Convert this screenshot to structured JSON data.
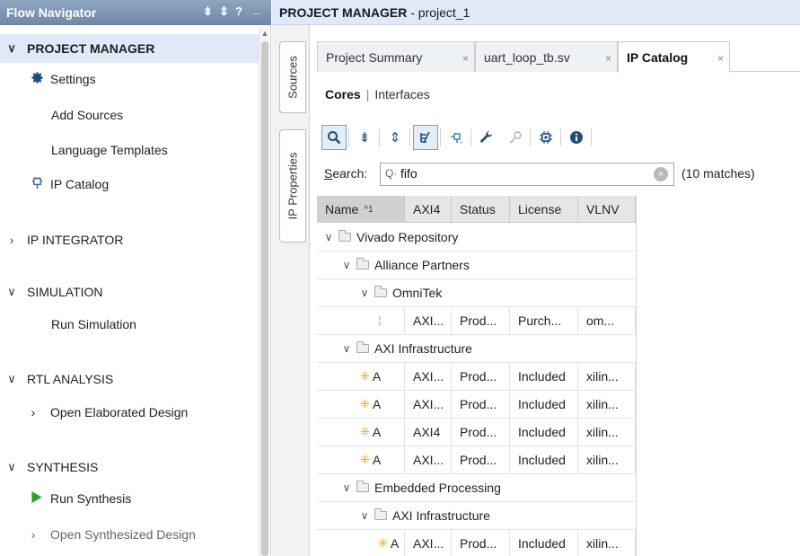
{
  "flow_navigator": {
    "title": "Flow Navigator",
    "header_icons": [
      "collapse-all-icon",
      "expand-all-icon",
      "help-icon",
      "minimize-icon"
    ],
    "header_glyphs": {
      "collapse": "⇟",
      "expand": "⇕",
      "help": "?",
      "minimize": "_"
    },
    "sections": {
      "project_manager": "PROJECT MANAGER",
      "ip_integrator": "IP INTEGRATOR",
      "simulation": "SIMULATION",
      "rtl_analysis": "RTL ANALYSIS",
      "synthesis": "SYNTHESIS"
    },
    "items": {
      "settings": "Settings",
      "add_sources": "Add Sources",
      "language_templates": "Language Templates",
      "ip_catalog": "IP Catalog",
      "run_simulation": "Run Simulation",
      "open_elaborated": "Open Elaborated Design",
      "run_synthesis": "Run Synthesis",
      "open_synthesized": "Open Synthesized Design"
    }
  },
  "main": {
    "header_bold": "PROJECT MANAGER",
    "header_rest": " - project_1",
    "side_tabs": [
      "Sources",
      "IP Properties"
    ],
    "tabs": [
      {
        "label": "Project Summary",
        "close": "×"
      },
      {
        "label": "uart_loop_tb.sv",
        "close": "×"
      },
      {
        "label": "IP Catalog",
        "close": "×",
        "active": true
      }
    ],
    "subnav": {
      "current": "Cores",
      "separator": "|",
      "other": "Interfaces"
    },
    "toolbar_icons": [
      "search-icon",
      "collapse-all-icon",
      "expand-all-icon",
      "hierarchy-filter-icon",
      "customize-ip-icon",
      "wrench-icon",
      "license-key-icon",
      "ip-chip-icon",
      "info-icon"
    ],
    "search": {
      "label_u": "S",
      "label_rest": "earch:",
      "value": "fifo",
      "matches": "(10 matches)"
    },
    "table": {
      "headers": [
        "Name",
        "AXI4",
        "Status",
        "License",
        "VLNV"
      ],
      "sort_indicator": "^1",
      "rows": [
        {
          "type": "group",
          "level": 0,
          "name": "Vivado Repository"
        },
        {
          "type": "group",
          "level": 1,
          "name": "Alliance Partners"
        },
        {
          "type": "group",
          "level": 2,
          "name": "OmniTek"
        },
        {
          "type": "ip",
          "level": 3,
          "icon": "blue",
          "name": "",
          "axi4": "AXI...",
          "status": "Prod...",
          "license": "Purch...",
          "vlnv": "om..."
        },
        {
          "type": "group",
          "level": 1,
          "name": "AXI Infrastructure"
        },
        {
          "type": "ip",
          "level": 2,
          "name": "A",
          "axi4": "AXI...",
          "status": "Prod...",
          "license": "Included",
          "vlnv": "xilin..."
        },
        {
          "type": "ip",
          "level": 2,
          "name": "A",
          "axi4": "AXI...",
          "status": "Prod...",
          "license": "Included",
          "vlnv": "xilin..."
        },
        {
          "type": "ip",
          "level": 2,
          "name": "A",
          "axi4": "AXI4",
          "status": "Prod...",
          "license": "Included",
          "vlnv": "xilin..."
        },
        {
          "type": "ip",
          "level": 2,
          "name": "A",
          "axi4": "AXI...",
          "status": "Prod...",
          "license": "Included",
          "vlnv": "xilin..."
        },
        {
          "type": "group",
          "level": 1,
          "name": "Embedded Processing"
        },
        {
          "type": "group",
          "level": 2,
          "name": "AXI Infrastructure"
        },
        {
          "type": "ip",
          "level": 3,
          "name": "A",
          "axi4": "AXI...",
          "status": "Prod...",
          "license": "Included",
          "vlnv": "xilin..."
        }
      ]
    }
  }
}
